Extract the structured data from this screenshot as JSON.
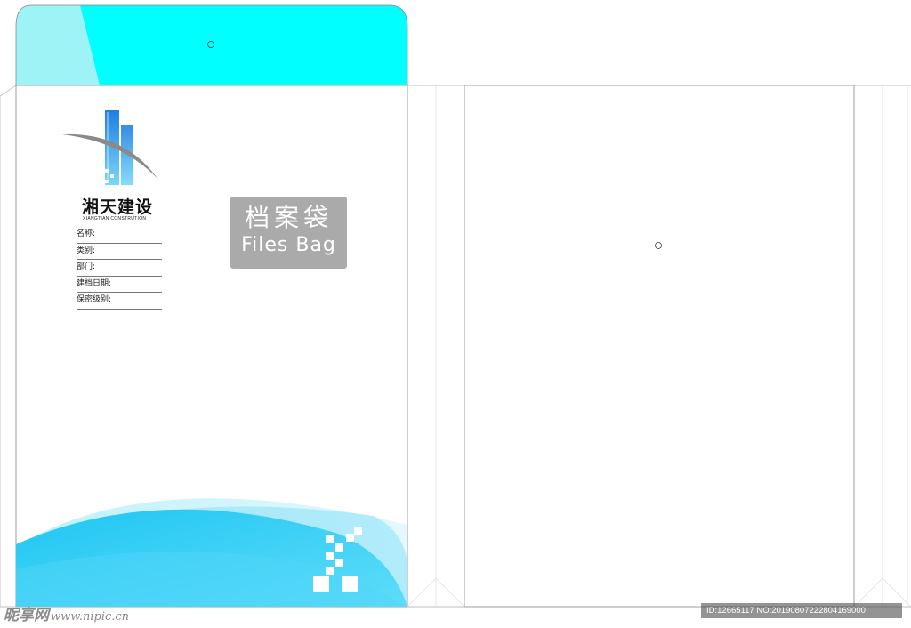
{
  "brand": {
    "name_cn": "湘天建设",
    "name_en": "XIANGTIAN CONSTRUTION"
  },
  "fields": [
    {
      "label": "名称:"
    },
    {
      "label": "类别:"
    },
    {
      "label": "部门:"
    },
    {
      "label": "建档日期:"
    },
    {
      "label": "保密级别:"
    }
  ],
  "title": {
    "cn": "档案袋",
    "en": "Files Bag"
  },
  "watermark": {
    "site": "昵享网",
    "url": "www.nipic.cn",
    "id_text": "ID:12665117 NO:20190807222804169000"
  },
  "colors": {
    "accent": "#00ffff",
    "wave": "#3dd0f5",
    "title_box": "#aaaaaa"
  }
}
